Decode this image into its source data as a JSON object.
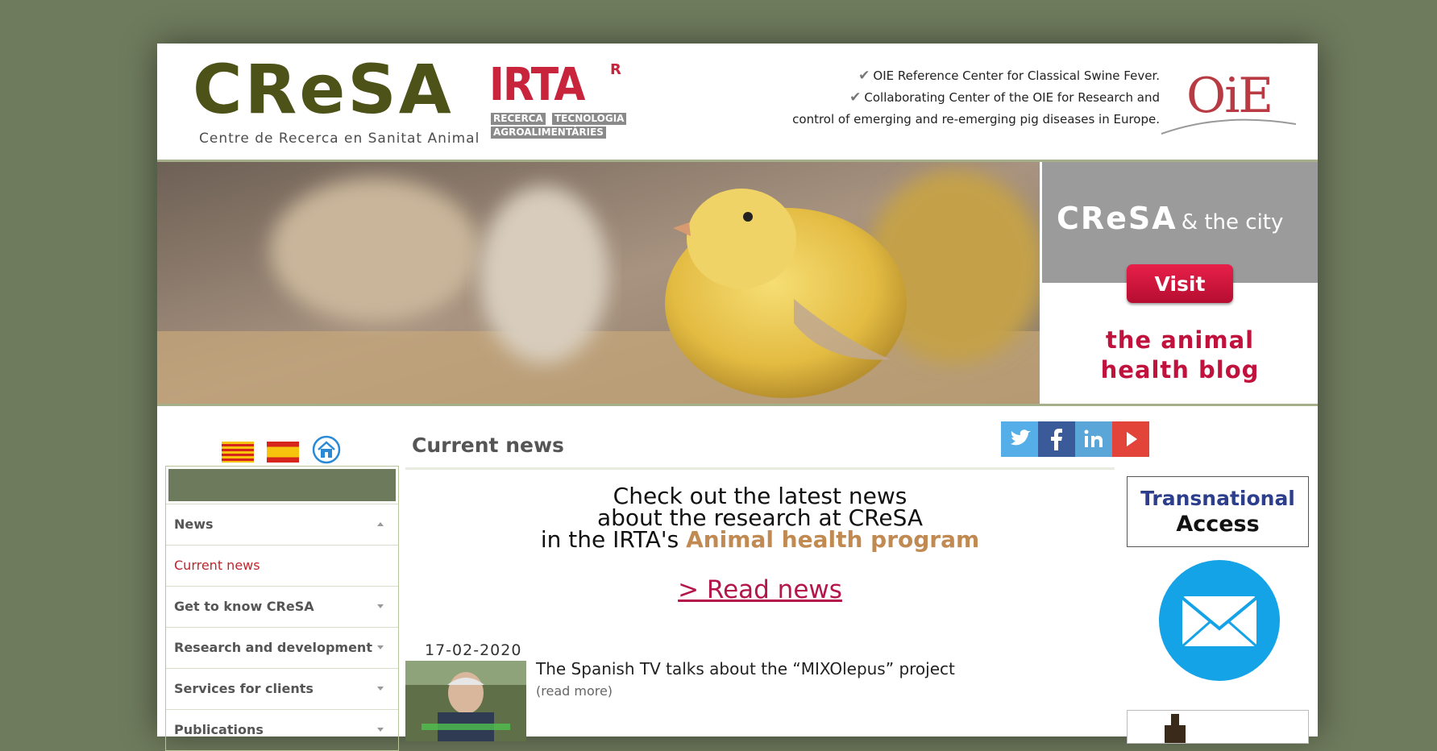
{
  "header": {
    "cresa_logo_word": "CReSA",
    "cresa_logo_subtitle": "Centre de Recerca en Sanitat Animal",
    "irta_logo_word": "IRTA",
    "irta_logo_mark": "R",
    "irta_tag_1": "RECERCA",
    "irta_tag_2": "TECNOLOGIA",
    "irta_tag_3": "AGROALIMENTÀRIES",
    "oie_line_1": "OIE Reference Center for Classical Swine Fever.",
    "oie_line_2": "Collaborating Center of the OIE for Research and",
    "oie_line_3": "control of emerging and re-emerging pig diseases in Europe.",
    "oie_logo_word": "OiE"
  },
  "banner": {
    "blog_title_bold": "CReSA",
    "blog_title_rest": "& the city",
    "visit_label": "Visit",
    "blog_line_1": "the animal",
    "blog_line_2": "health blog"
  },
  "sidebar": {
    "flags": [
      "catalan-flag",
      "spanish-flag"
    ],
    "home_icon": "home-icon",
    "items": [
      {
        "label": "News",
        "expanded": true
      },
      {
        "label": "Current news",
        "sub": true
      },
      {
        "label": "Get to know CReSA"
      },
      {
        "label": "Research and development"
      },
      {
        "label": "Services for clients"
      },
      {
        "label": "Publications"
      }
    ]
  },
  "main": {
    "heading": "Current news",
    "intro_line_1": "Check out the latest news",
    "intro_line_2": "about the research at CReSA",
    "intro_line_3_prefix": "in the IRTA's",
    "intro_line_3_highlight": "Animal health program",
    "read_news": "> Read news",
    "news": [
      {
        "date": "17-02-2020",
        "title": "The Spanish TV talks about the “MIXOlepus” project",
        "more": "(read more)"
      }
    ]
  },
  "right": {
    "social": [
      "twitter-icon",
      "facebook-icon",
      "linkedin-icon",
      "youtube-icon"
    ],
    "transnational_line_1": "Transnational",
    "transnational_line_2": "Access",
    "mail_icon": "mail-icon"
  },
  "colors": {
    "background": "#6f7b5d",
    "accent_red": "#c0242c",
    "program_brown": "#c08a52",
    "link_crimson": "#b4154a"
  }
}
